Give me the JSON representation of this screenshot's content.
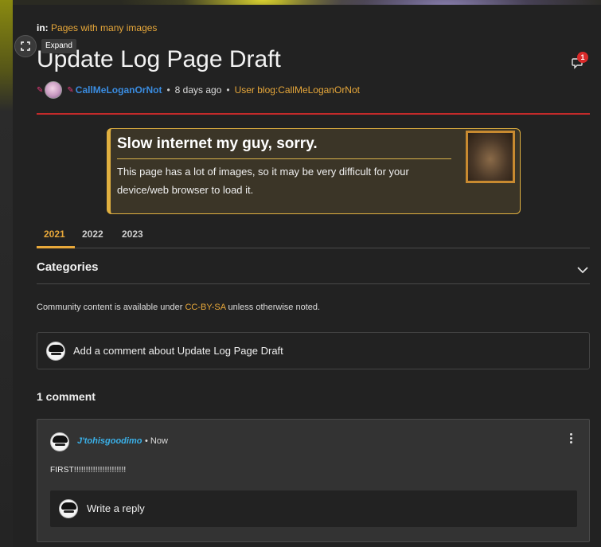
{
  "expand": {
    "tooltip": "Expand"
  },
  "breadcrumb": {
    "prefix": "in:",
    "category": "Pages with many images"
  },
  "page": {
    "title": "Update Log Page Draft",
    "comment_count_badge": "1"
  },
  "meta": {
    "author": "CallMeLoganOrNot",
    "time": "8 days ago",
    "blog_link": "User blog:CallMeLoganOrNot",
    "separator": "•"
  },
  "notice": {
    "title": "Slow internet my guy, sorry.",
    "text": "This page has a lot of images, so it may be very difficult for your device/web browser to load it."
  },
  "tabs": [
    {
      "label": "2021",
      "active": true
    },
    {
      "label": "2022",
      "active": false
    },
    {
      "label": "2023",
      "active": false
    }
  ],
  "categories": {
    "label": "Categories"
  },
  "license": {
    "before": "Community content is available under ",
    "link": "CC-BY-SA",
    "after": " unless otherwise noted."
  },
  "add_comment": {
    "placeholder": "Add a comment about Update Log Page Draft"
  },
  "comments_header": {
    "label": "1 comment"
  },
  "comments": [
    {
      "author": "J'tohisgoodimo",
      "time": "• Now",
      "body": "FIRST!!!!!!!!!!!!!!!!!!!!!!",
      "reply_placeholder": "Write a reply"
    }
  ],
  "colors": {
    "accent": "#e8a83a",
    "link_blue": "#3a8ce0",
    "divider_red": "#c42a2a",
    "badge_red": "#d92a2a"
  }
}
